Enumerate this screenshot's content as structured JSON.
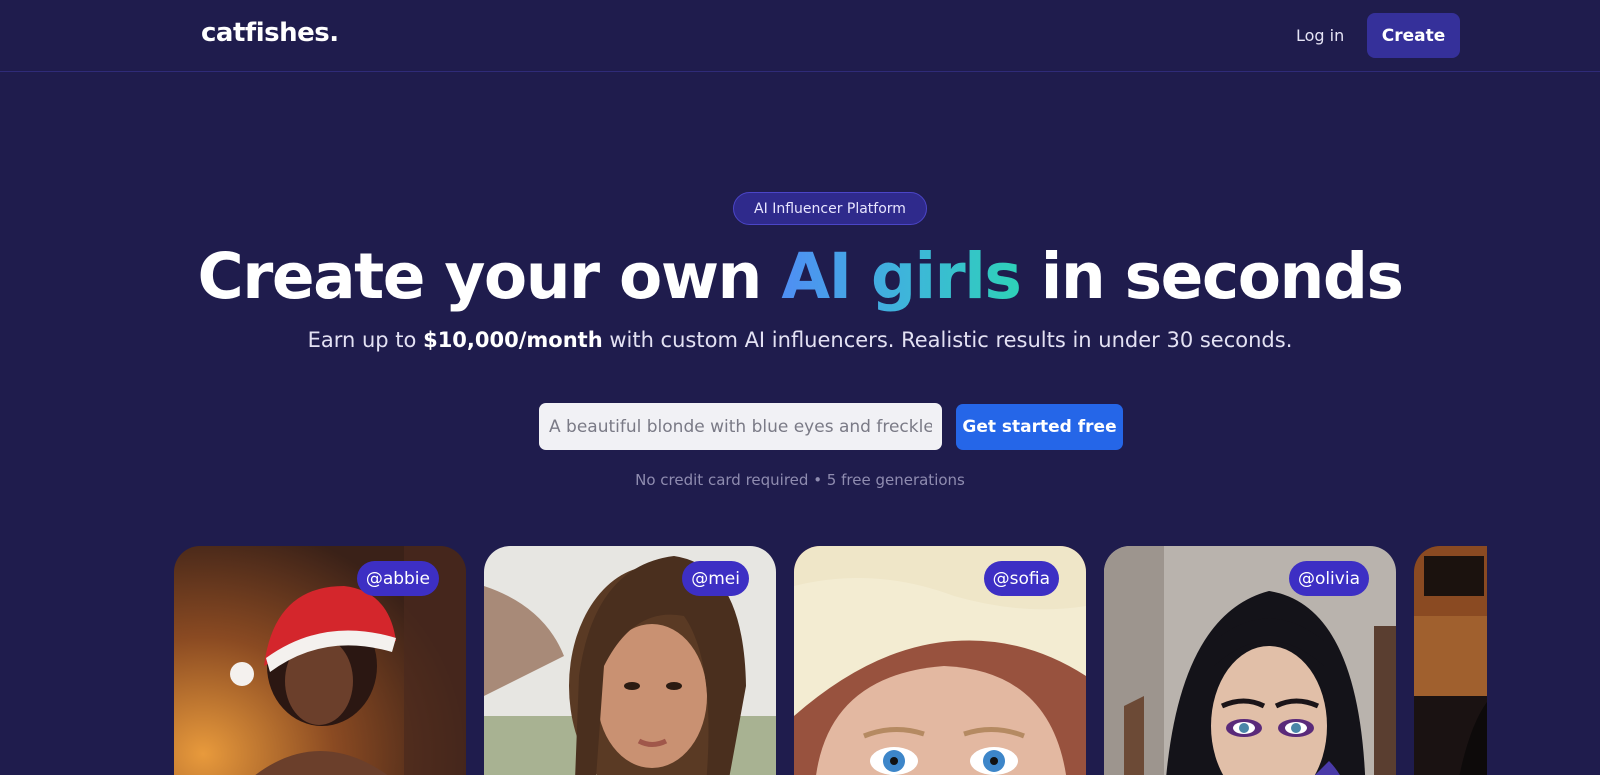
{
  "header": {
    "logo": "catfishes.",
    "login_label": "Log in",
    "create_label": "Create"
  },
  "hero": {
    "badge": "AI Influencer Platform",
    "headline_pre": "Create your own ",
    "headline_accent": "AI girls",
    "headline_post": " in seconds",
    "sub_pre": "Earn up to ",
    "sub_bold": "$10,000/month",
    "sub_post": " with custom AI influencers. Realistic results in under 30 seconds.",
    "input_placeholder": "A beautiful blonde with blue eyes and freckles",
    "cta_label": "Get started free",
    "fineprint": "No credit card required • 5 free generations"
  },
  "gallery": {
    "cards": [
      {
        "handle": "@abbie"
      },
      {
        "handle": "@mei"
      },
      {
        "handle": "@sofia"
      },
      {
        "handle": "@olivia"
      },
      {
        "handle": ""
      }
    ]
  },
  "colors": {
    "background": "#1f1c4d",
    "primary_button": "#2566e8",
    "create_button": "#35309a",
    "handle_pill": "#3d2fc4",
    "accent_gradient_start": "#4f8ef4",
    "accent_gradient_end": "#2ed1b8"
  }
}
